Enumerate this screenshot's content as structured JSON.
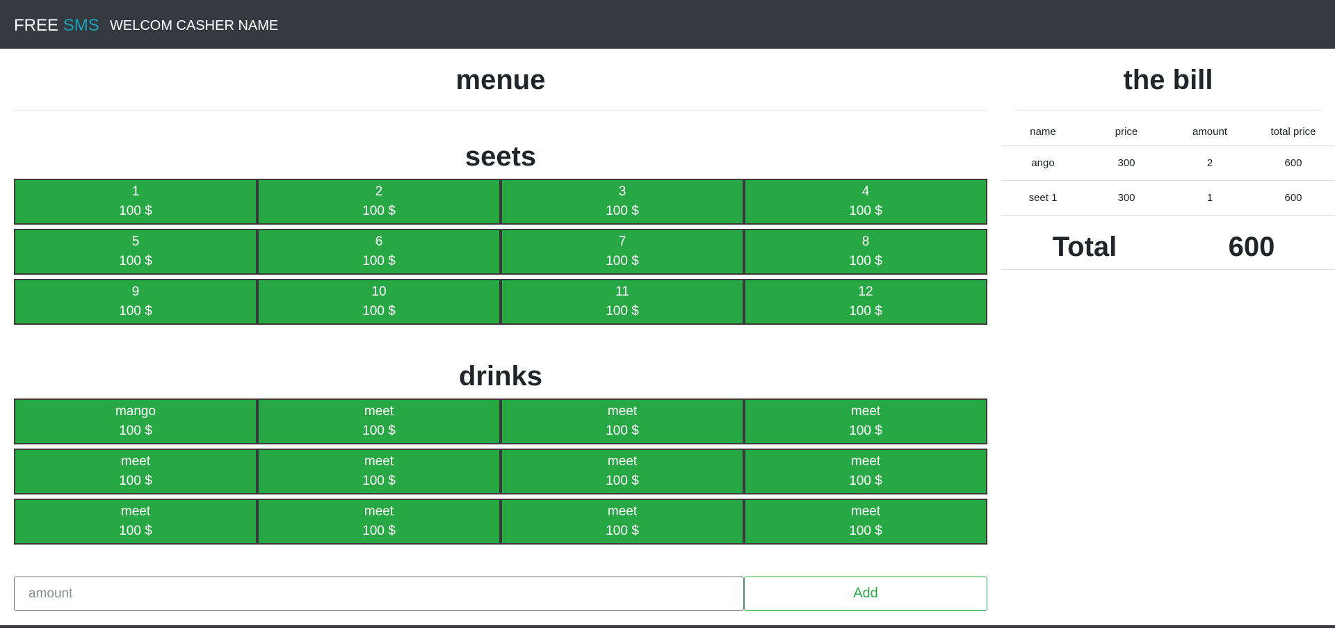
{
  "navbar": {
    "brand_main": "FREE",
    "brand_accent": "SMS",
    "welcome": "WELCOM CASHER NAME"
  },
  "menu": {
    "title": "menue",
    "seets_title": "seets",
    "drinks_title": "drinks",
    "seets": [
      {
        "name": "1",
        "price": "100 $"
      },
      {
        "name": "2",
        "price": "100 $"
      },
      {
        "name": "3",
        "price": "100 $"
      },
      {
        "name": "4",
        "price": "100 $"
      },
      {
        "name": "5",
        "price": "100 $"
      },
      {
        "name": "6",
        "price": "100 $"
      },
      {
        "name": "7",
        "price": "100 $"
      },
      {
        "name": "8",
        "price": "100 $"
      },
      {
        "name": "9",
        "price": "100 $"
      },
      {
        "name": "10",
        "price": "100 $"
      },
      {
        "name": "11",
        "price": "100 $"
      },
      {
        "name": "12",
        "price": "100 $"
      }
    ],
    "drinks": [
      {
        "name": "mango",
        "price": "100 $"
      },
      {
        "name": "meet",
        "price": "100 $"
      },
      {
        "name": "meet",
        "price": "100 $"
      },
      {
        "name": "meet",
        "price": "100 $"
      },
      {
        "name": "meet",
        "price": "100 $"
      },
      {
        "name": "meet",
        "price": "100 $"
      },
      {
        "name": "meet",
        "price": "100 $"
      },
      {
        "name": "meet",
        "price": "100 $"
      },
      {
        "name": "meet",
        "price": "100 $"
      },
      {
        "name": "meet",
        "price": "100 $"
      },
      {
        "name": "meet",
        "price": "100 $"
      },
      {
        "name": "meet",
        "price": "100 $"
      }
    ],
    "amount_placeholder": "amount",
    "add_label": "Add"
  },
  "bill": {
    "title": "the bill",
    "headers": [
      "name",
      "price",
      "amount",
      "total price"
    ],
    "rows": [
      [
        "ango",
        "300",
        "2",
        "600"
      ],
      [
        "seet 1",
        "300",
        "1",
        "600"
      ]
    ],
    "total_label": "Total",
    "total_value": "600"
  },
  "colors": {
    "navbar": "#343a40",
    "accent": "#17a2b8",
    "tile": "#28a745"
  }
}
